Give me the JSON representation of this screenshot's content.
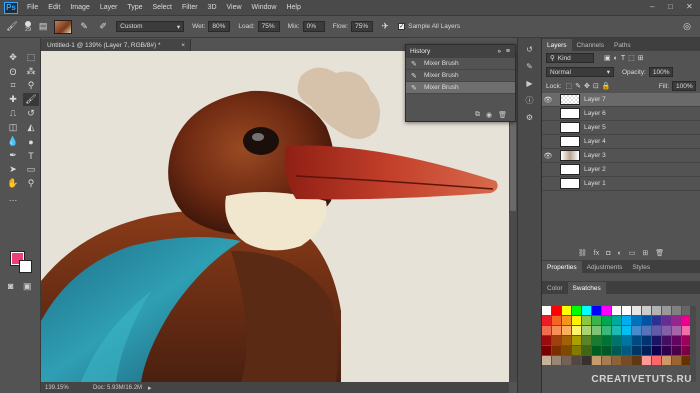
{
  "app": {
    "logo": "Ps"
  },
  "menu": [
    "File",
    "Edit",
    "Image",
    "Layer",
    "Type",
    "Select",
    "Filter",
    "3D",
    "View",
    "Window",
    "Help"
  ],
  "window_controls": {
    "minimize": "–",
    "maximize": "□",
    "close": "✕"
  },
  "options": {
    "brush_size": "29",
    "mode_value": "Custom",
    "wet_label": "Wet:",
    "wet_value": "80%",
    "load_label": "Load:",
    "load_value": "75%",
    "mix_label": "Mix:",
    "mix_value": "0%",
    "flow_label": "Flow:",
    "flow_value": "75%",
    "sample_all_layers": "Sample All Layers"
  },
  "document": {
    "tab_title": "Untitled-1 @ 139% (Layer 7, RGB/8#) *",
    "tab_close": "×"
  },
  "status": {
    "zoom": "139.15%",
    "doc": "Doc: 5.93M/16.2M"
  },
  "history": {
    "title": "History",
    "rows": [
      {
        "label": "Mixer Brush"
      },
      {
        "label": "Mixer Brush"
      },
      {
        "label": "Mixer Brush"
      }
    ]
  },
  "layers_panel": {
    "tabs": [
      "Layers",
      "Channels",
      "Paths"
    ],
    "kind": "Kind",
    "blend": "Normal",
    "opacity_label": "Opacity:",
    "opacity_value": "100%",
    "lock_label": "Lock:",
    "fill_label": "Fill:",
    "fill_value": "100%",
    "layers": [
      {
        "name": "Layer 7",
        "visible": true,
        "selected": true
      },
      {
        "name": "Layer 6",
        "visible": false,
        "selected": false
      },
      {
        "name": "Layer 5",
        "visible": false,
        "selected": false
      },
      {
        "name": "Layer 4",
        "visible": false,
        "selected": false
      },
      {
        "name": "Layer 3",
        "visible": true,
        "selected": false
      },
      {
        "name": "Layer 2",
        "visible": false,
        "selected": false
      },
      {
        "name": "Layer 1",
        "visible": false,
        "selected": false
      }
    ]
  },
  "props_tabs": [
    "Properties",
    "Adjustments",
    "Styles"
  ],
  "color_tabs": [
    "Color",
    "Swatches"
  ],
  "swatches": [
    "#ffffff",
    "#ff0000",
    "#ffff00",
    "#00ff00",
    "#00ffff",
    "#0000ff",
    "#ff00ff",
    "#ffffff",
    "#ffffff",
    "#e6e6e6",
    "#cccccc",
    "#b3b3b3",
    "#999999",
    "#808080",
    "#666666",
    "#ed1c24",
    "#f26522",
    "#f7941d",
    "#fff200",
    "#8dc63f",
    "#39b54a",
    "#00a651",
    "#00a99d",
    "#00aeef",
    "#0072bc",
    "#0054a6",
    "#2e3192",
    "#662d91",
    "#92278f",
    "#ec008c",
    "#f26c4f",
    "#f68e56",
    "#fbaf5d",
    "#fff568",
    "#acd373",
    "#7cc576",
    "#3cb878",
    "#1cbbb4",
    "#00bff3",
    "#448ccb",
    "#5674b9",
    "#605ca8",
    "#8560a8",
    "#a864a8",
    "#f06ea9",
    "#9e0b0f",
    "#a0410d",
    "#a36209",
    "#aba000",
    "#598527",
    "#197b30",
    "#007236",
    "#00746b",
    "#0076a3",
    "#004a80",
    "#003471",
    "#1b1464",
    "#440e62",
    "#630460",
    "#9e005d",
    "#790000",
    "#7b2e00",
    "#7d4900",
    "#827b00",
    "#406618",
    "#005e20",
    "#005826",
    "#005952",
    "#005b7f",
    "#003663",
    "#002157",
    "#0d004c",
    "#32004b",
    "#4b0049",
    "#7b0046",
    "#c7b299",
    "#998675",
    "#736357",
    "#534741",
    "#37302d",
    "#c69c6d",
    "#a67c52",
    "#8c6239",
    "#754c24",
    "#603913",
    "#ff9999",
    "#ff6666",
    "#cc9966",
    "#996633",
    "#663300"
  ],
  "watermark": "CREATIVETUTS.RU"
}
